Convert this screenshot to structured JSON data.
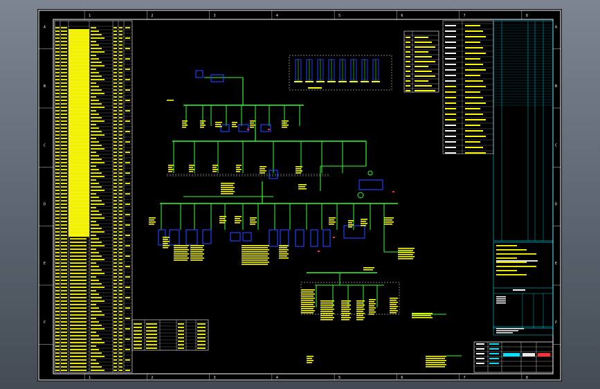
{
  "window": {
    "background_top": "#7d8590",
    "background_bottom": "#444b55"
  },
  "drawing": {
    "sheet_background": "#000000",
    "frame_color": "#ffffff",
    "line_color": "#33ff33",
    "table_text_color": "#ffff00",
    "table_line_color": "#ffffff",
    "equipment_color": "#1e40ff",
    "title_block_color": "#00e5ff",
    "accent_color": "#ff3333",
    "border_zones_top": [
      "1",
      "2",
      "3",
      "4",
      "5",
      "6",
      "7",
      "8"
    ],
    "border_zones_side": [
      "A",
      "B",
      "C",
      "D",
      "E",
      "F"
    ]
  }
}
